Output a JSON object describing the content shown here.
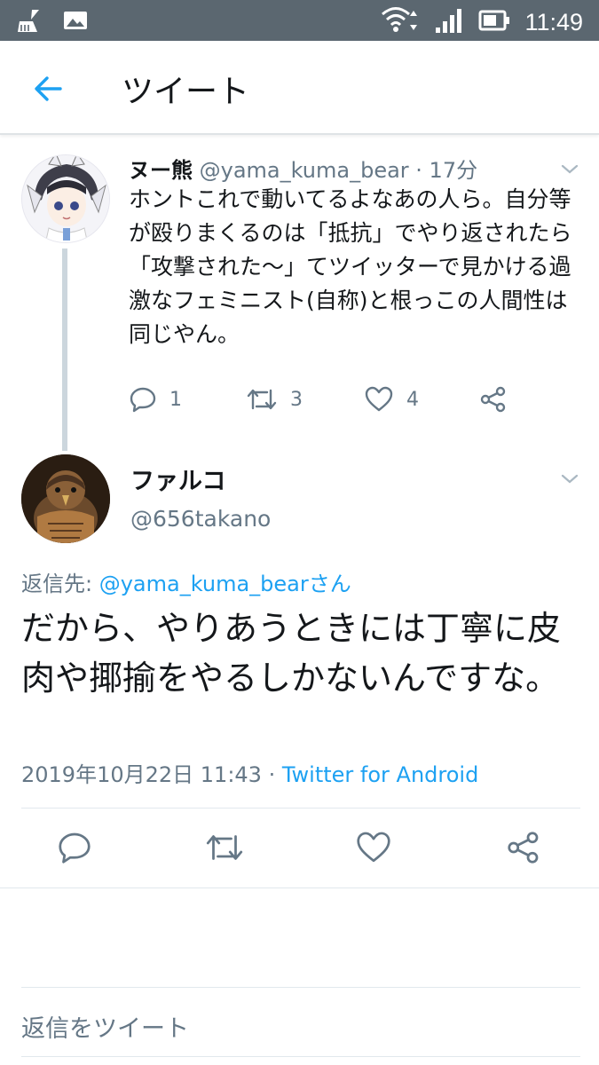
{
  "status_bar": {
    "time": "11:49",
    "left_icons": [
      "broom-icon",
      "image-icon"
    ],
    "right_icons": [
      "wifi-icon",
      "signal-icon",
      "battery-icon"
    ]
  },
  "header": {
    "title": "ツイート"
  },
  "parent_tweet": {
    "name": "ヌー熊",
    "meta": "@yama_kuma_bear · 17分",
    "text": "ホントこれで動いてるよなあの人ら。自分等が殴りまくるのは「抵抗」でやり返されたら「攻撃された〜」てツイッターで見かける過激なフェミニスト(自称)と根っこの人間性は同じやん。",
    "replies": "1",
    "retweets": "3",
    "likes": "4"
  },
  "main_tweet": {
    "name": "ファルコ",
    "handle": "@656takano",
    "reply_prefix": "返信先: ",
    "reply_target": "@yama_kuma_bearさん",
    "text": "だから、やりあうときには丁寧に皮肉や揶揄をやるしかないんですな。",
    "date": "2019年10月22日 11:43 · ",
    "source": "Twitter for Android"
  },
  "reply_box": {
    "placeholder": "返信をツイート"
  },
  "colors": {
    "status_bar": "#5b6770",
    "accent": "#1da1f2",
    "muted": "#657786",
    "text": "#14171a"
  }
}
